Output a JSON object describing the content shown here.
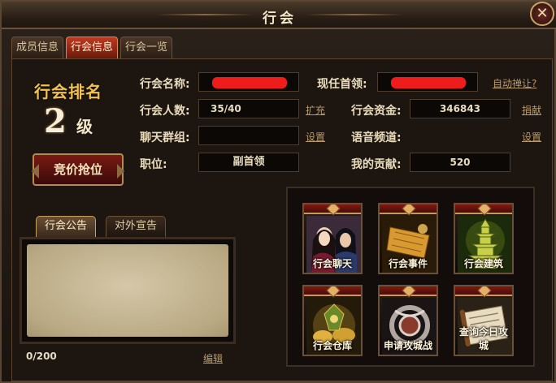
{
  "window": {
    "title": "行会",
    "close_glyph": "✕"
  },
  "tabs": [
    "成员信息",
    "行会信息",
    "行会一览"
  ],
  "rank": {
    "title": "行会排名",
    "value": "2",
    "unit": "级"
  },
  "bid_button": "竞价抢位",
  "fields": {
    "guild_name_label": "行会名称:",
    "leader_label": "现任首领:",
    "auto_abdicate_link": "自动禅让?",
    "members_label": "行会人数:",
    "members_value": "35/40",
    "expand_link": "扩充",
    "funds_label": "行会资金:",
    "funds_value": "346843",
    "donate_link": "捐献",
    "chat_group_label": "聊天群组:",
    "chat_group_set_link": "设置",
    "voice_channel_label": "语音频道:",
    "voice_channel_set_link": "设置",
    "position_label": "职位:",
    "position_value": "副首领",
    "contribution_label": "我的贡献:",
    "contribution_value": "520"
  },
  "notice": {
    "tabs": [
      "行会公告",
      "对外宣告"
    ],
    "count": "0/200",
    "edit_link": "编辑"
  },
  "features": [
    "行会聊天",
    "行会事件",
    "行会建筑",
    "行会仓库",
    "申请攻城战",
    "查询今日攻城"
  ],
  "colors": {
    "accent_red": "#c03a20",
    "gold": "#f2c24a",
    "redaction": "#ef1c1c"
  },
  "icons": [
    "close-icon",
    "ornament-arrow-icon"
  ]
}
